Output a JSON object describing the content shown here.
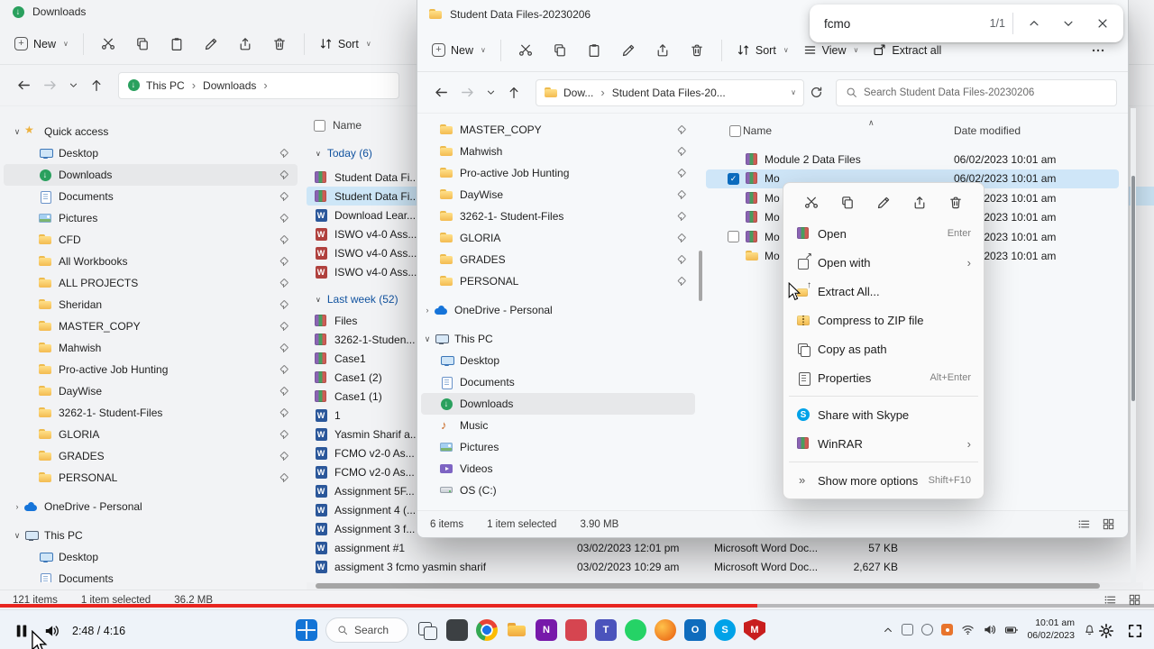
{
  "bg_window": {
    "title": "Downloads",
    "cmdbar": {
      "new_label": "New",
      "sort_label": "Sort"
    },
    "breadcrumbs": [
      "This PC",
      "Downloads"
    ],
    "sidebar": [
      {
        "label": "Quick access",
        "icon": "star",
        "chev": "∨",
        "top": true
      },
      {
        "label": "Desktop",
        "icon": "desktop",
        "pin": true
      },
      {
        "label": "Downloads",
        "icon": "downloads",
        "pin": true,
        "sel": true
      },
      {
        "label": "Documents",
        "icon": "documents",
        "pin": true
      },
      {
        "label": "Pictures",
        "icon": "pictures",
        "pin": true
      },
      {
        "label": "CFD",
        "icon": "folder",
        "pin": true
      },
      {
        "label": "All Workbooks",
        "icon": "folder",
        "pin": true
      },
      {
        "label": "ALL PROJECTS",
        "icon": "folder",
        "pin": true
      },
      {
        "label": "Sheridan",
        "icon": "folder",
        "pin": true
      },
      {
        "label": "MASTER_COPY",
        "icon": "folder",
        "pin": true
      },
      {
        "label": "Mahwish",
        "icon": "folder",
        "pin": true
      },
      {
        "label": "Pro-active Job Hunting",
        "icon": "folder",
        "pin": true
      },
      {
        "label": "DayWise",
        "icon": "folder",
        "pin": true
      },
      {
        "label": "3262-1- Student-Files",
        "icon": "folder",
        "pin": true
      },
      {
        "label": "GLORIA",
        "icon": "folder",
        "pin": true
      },
      {
        "label": "GRADES",
        "icon": "folder",
        "pin": true
      },
      {
        "label": "PERSONAL",
        "icon": "folder",
        "pin": true
      },
      {
        "label": "OneDrive - Personal",
        "icon": "cloud",
        "chev": "›",
        "top": true,
        "gap": true
      },
      {
        "label": "This PC",
        "icon": "pc",
        "chev": "∨",
        "top": true,
        "gap": true
      },
      {
        "label": "Desktop",
        "icon": "desktop"
      },
      {
        "label": "Documents",
        "icon": "documents"
      }
    ],
    "list": {
      "name_header": "Name",
      "today_label": "Today (6)",
      "today": [
        {
          "label": "Student Data Fi...",
          "icon": "rar"
        },
        {
          "label": "Student Data Fi...",
          "icon": "rar",
          "sel": true
        },
        {
          "label": "Download Lear...",
          "icon": "doc"
        },
        {
          "label": "ISWO v4-0 Ass...",
          "icon": "docred"
        },
        {
          "label": "ISWO v4-0 Ass...",
          "icon": "docred"
        },
        {
          "label": "ISWO v4-0 Ass...",
          "icon": "docred"
        }
      ],
      "lastweek_label": "Last week (52)",
      "lastweek": [
        {
          "label": "Files",
          "icon": "rar"
        },
        {
          "label": "3262-1-Studen...",
          "icon": "rar"
        },
        {
          "label": "Case1",
          "icon": "rar"
        },
        {
          "label": "Case1 (2)",
          "icon": "rar"
        },
        {
          "label": "Case1 (1)",
          "icon": "rar"
        },
        {
          "label": "1",
          "icon": "doc"
        },
        {
          "label": "Yasmin Sharif a...",
          "icon": "doc"
        },
        {
          "label": "FCMO v2-0 As...",
          "icon": "doc"
        },
        {
          "label": "FCMO v2-0 As...",
          "icon": "doc"
        },
        {
          "label": "Assignment 5F...",
          "icon": "doc"
        },
        {
          "label": "Assignment 4 (...",
          "icon": "doc"
        },
        {
          "label": "Assignment 3 f...",
          "icon": "doc"
        },
        {
          "label": "assignment #1",
          "icon": "doc",
          "date": "03/02/2023 12:01 pm",
          "type": "Microsoft Word Doc...",
          "size": "57 KB"
        },
        {
          "label": "assigment 3 fcmo yasmin sharif",
          "icon": "doc",
          "date": "03/02/2023 10:29 am",
          "type": "Microsoft Word Doc...",
          "size": "2,627 KB"
        }
      ]
    },
    "status": {
      "items": "121 items",
      "selected": "1 item selected",
      "size": "36.2 MB"
    }
  },
  "fg_window": {
    "title": "Student Data Files-20230206",
    "cmdbar": {
      "new_label": "New",
      "sort_label": "Sort",
      "view_label": "View",
      "extract_label": "Extract all"
    },
    "breadcrumbs": [
      "Dow...",
      "Student Data Files-20..."
    ],
    "search_placeholder": "Search Student Data Files-20230206",
    "sidebar": [
      {
        "label": "MASTER_COPY",
        "icon": "folder",
        "pin": true
      },
      {
        "label": "Mahwish",
        "icon": "folder",
        "pin": true
      },
      {
        "label": "Pro-active Job Hunting",
        "icon": "folder",
        "pin": true
      },
      {
        "label": "DayWise",
        "icon": "folder",
        "pin": true
      },
      {
        "label": "3262-1- Student-Files",
        "icon": "folder",
        "pin": true
      },
      {
        "label": "GLORIA",
        "icon": "folder",
        "pin": true
      },
      {
        "label": "GRADES",
        "icon": "folder",
        "pin": true
      },
      {
        "label": "PERSONAL",
        "icon": "folder",
        "pin": true
      },
      {
        "label": "OneDrive - Personal",
        "icon": "cloud",
        "chev": "›",
        "top": true,
        "gap": true
      },
      {
        "label": "This PC",
        "icon": "pc",
        "chev": "∨",
        "top": true,
        "gap": true
      },
      {
        "label": "Desktop",
        "icon": "desktop"
      },
      {
        "label": "Documents",
        "icon": "documents"
      },
      {
        "label": "Downloads",
        "icon": "downloads",
        "sel": true
      },
      {
        "label": "Music",
        "icon": "music"
      },
      {
        "label": "Pictures",
        "icon": "pictures"
      },
      {
        "label": "Videos",
        "icon": "videos"
      },
      {
        "label": "OS (C:)",
        "icon": "drive"
      }
    ],
    "list": {
      "name_header": "Name",
      "date_header": "Date modified",
      "rows": [
        {
          "label": "Module 2 Data Files",
          "icon": "rar",
          "date": "06/02/2023 10:01 am"
        },
        {
          "label": "Mo",
          "icon": "rar",
          "date": "06/02/2023 10:01 am",
          "sel": true,
          "check": "checked"
        },
        {
          "label": "Mo",
          "icon": "rar",
          "date": "06/02/2023 10:01 am"
        },
        {
          "label": "Mo",
          "icon": "rar",
          "date": "06/02/2023 10:01 am"
        },
        {
          "label": "Mo",
          "icon": "rar",
          "date": "06/02/2023 10:01 am",
          "check": "empty"
        },
        {
          "label": "Mo",
          "icon": "folder",
          "date": "06/02/2023 10:01 am"
        }
      ]
    },
    "status": {
      "items": "6 items",
      "selected": "1 item selected",
      "size": "3.90 MB"
    }
  },
  "context_menu": {
    "items": [
      {
        "label": "Open",
        "icon": "rar",
        "shortcut": "Enter"
      },
      {
        "label": "Open with",
        "icon": "openwith",
        "submenu": true
      },
      {
        "label": "Extract All...",
        "icon": "extract"
      },
      {
        "label": "Compress to ZIP file",
        "icon": "zip"
      },
      {
        "label": "Copy as path",
        "icon": "copypath"
      },
      {
        "label": "Properties",
        "icon": "props",
        "shortcut": "Alt+Enter"
      },
      {
        "label": "Share with Skype",
        "icon": "skype",
        "sep": true
      },
      {
        "label": "WinRAR",
        "icon": "rar",
        "submenu": true
      },
      {
        "label": "Show more options",
        "icon": "more",
        "shortcut": "Shift+F10",
        "sep": true
      }
    ]
  },
  "find_bar": {
    "query": "fcmo",
    "matches": "1/1"
  },
  "taskbar": {
    "search_label": "Search",
    "clock_time": "10:01 am",
    "clock_date": "06/02/2023",
    "apps": [
      {
        "name": "task-view-icon",
        "style": "taskview"
      },
      {
        "name": "pinned-app-icon-1",
        "style": "dark"
      },
      {
        "name": "chrome-icon",
        "style": "chrome"
      },
      {
        "name": "file-explorer-icon",
        "style": "explorer"
      },
      {
        "name": "onenote-icon",
        "style": "purple",
        "letter": "N"
      },
      {
        "name": "pinned-app-icon-2",
        "style": "pink"
      },
      {
        "name": "teams-icon",
        "style": "indigo",
        "letter": "T"
      },
      {
        "name": "whatsapp-icon",
        "style": "green"
      },
      {
        "name": "firefox-icon",
        "style": "orange"
      },
      {
        "name": "outlook-icon",
        "style": "blue",
        "letter": "O"
      },
      {
        "name": "skype-icon",
        "style": "skyblue",
        "letter": "S"
      },
      {
        "name": "mcafee-icon",
        "style": "shield",
        "letter": "M"
      }
    ]
  },
  "player": {
    "time": "2:48 / 4:16",
    "progress_pct": 65.6
  }
}
